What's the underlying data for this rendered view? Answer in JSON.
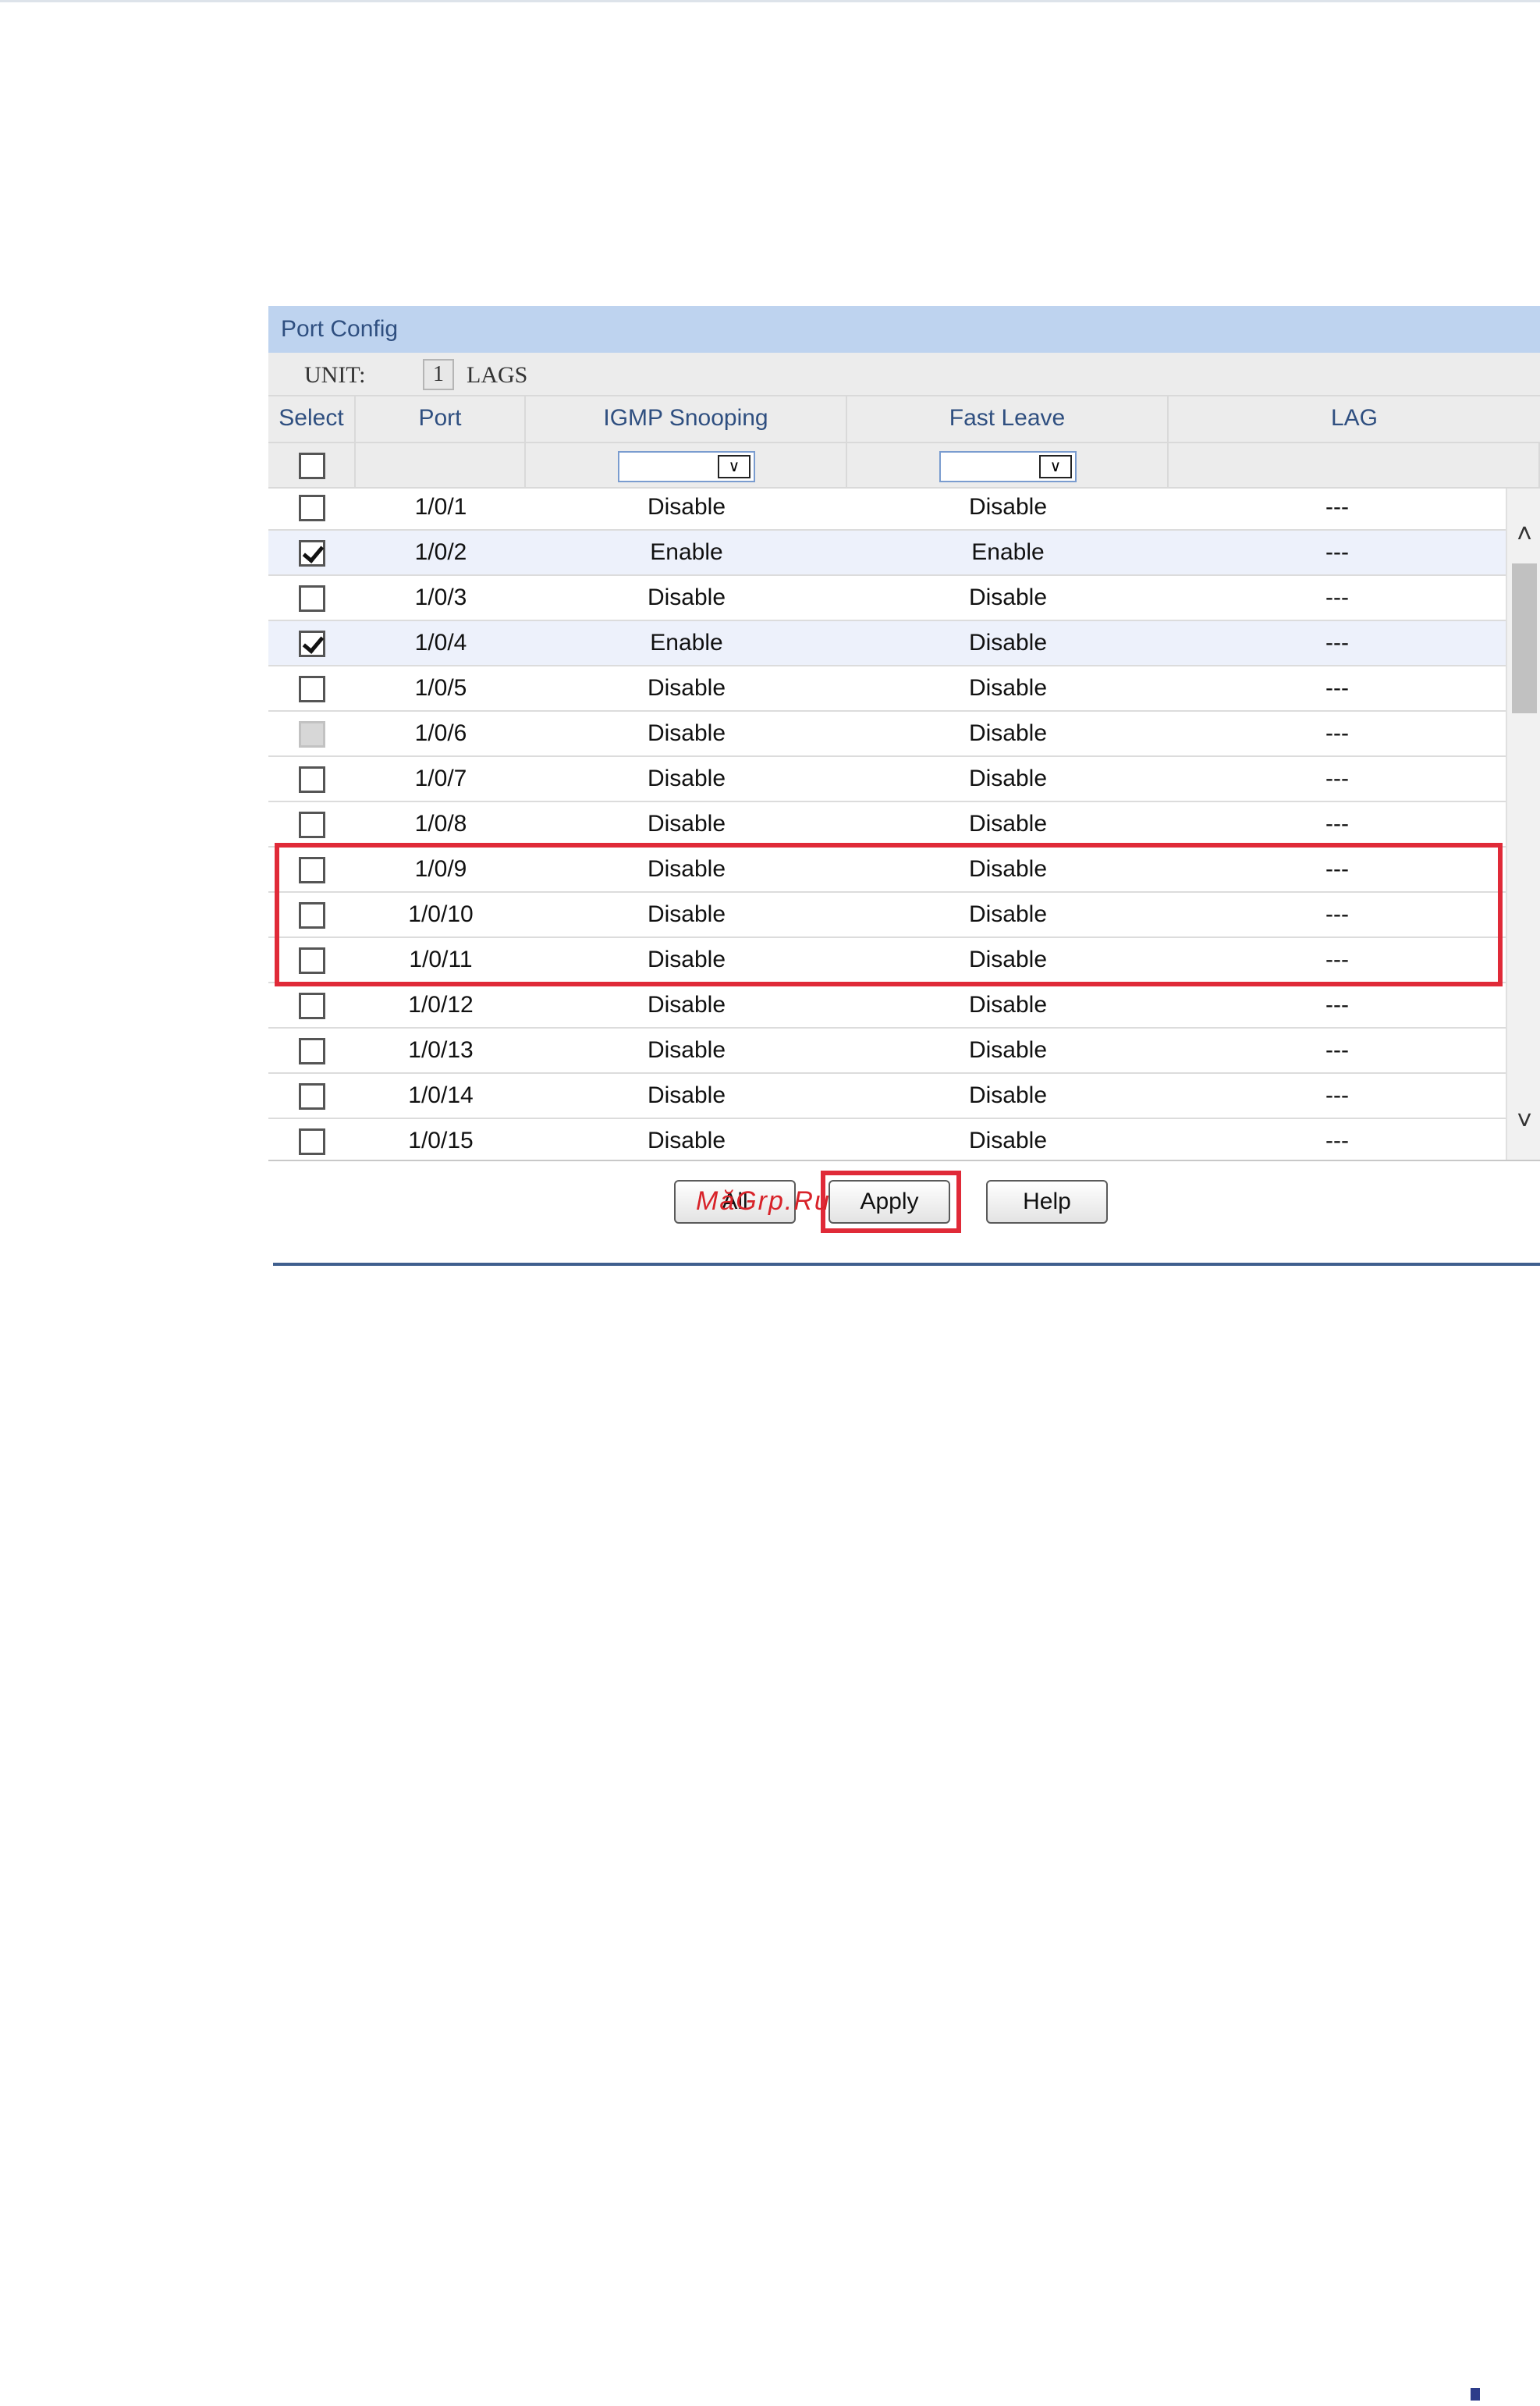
{
  "panel": {
    "title": "Port Config",
    "unit_label": "UNIT:",
    "unit_value": "1",
    "lags_label": "LAGS"
  },
  "table": {
    "headers": [
      "Select",
      "Port",
      "IGMP Snooping",
      "Fast Leave",
      "LAG"
    ],
    "filter": {
      "igmp_snooping": "",
      "fast_leave": ""
    },
    "rows": [
      {
        "select": "unchecked",
        "port": "1/0/1",
        "igmp": "Disable",
        "fast_leave": "Disable",
        "lag": "---"
      },
      {
        "select": "checked",
        "port": "1/0/2",
        "igmp": "Enable",
        "fast_leave": "Enable",
        "lag": "---"
      },
      {
        "select": "unchecked",
        "port": "1/0/3",
        "igmp": "Disable",
        "fast_leave": "Disable",
        "lag": "---"
      },
      {
        "select": "checked",
        "port": "1/0/4",
        "igmp": "Enable",
        "fast_leave": "Disable",
        "lag": "---"
      },
      {
        "select": "unchecked",
        "port": "1/0/5",
        "igmp": "Disable",
        "fast_leave": "Disable",
        "lag": "---"
      },
      {
        "select": "disabled",
        "port": "1/0/6",
        "igmp": "Disable",
        "fast_leave": "Disable",
        "lag": "---"
      },
      {
        "select": "unchecked",
        "port": "1/0/7",
        "igmp": "Disable",
        "fast_leave": "Disable",
        "lag": "---"
      },
      {
        "select": "unchecked",
        "port": "1/0/8",
        "igmp": "Disable",
        "fast_leave": "Disable",
        "lag": "---"
      },
      {
        "select": "unchecked",
        "port": "1/0/9",
        "igmp": "Disable",
        "fast_leave": "Disable",
        "lag": "---"
      },
      {
        "select": "unchecked",
        "port": "1/0/10",
        "igmp": "Disable",
        "fast_leave": "Disable",
        "lag": "---"
      },
      {
        "select": "unchecked",
        "port": "1/0/11",
        "igmp": "Disable",
        "fast_leave": "Disable",
        "lag": "---"
      },
      {
        "select": "unchecked",
        "port": "1/0/12",
        "igmp": "Disable",
        "fast_leave": "Disable",
        "lag": "---"
      },
      {
        "select": "unchecked",
        "port": "1/0/13",
        "igmp": "Disable",
        "fast_leave": "Disable",
        "lag": "---"
      },
      {
        "select": "unchecked",
        "port": "1/0/14",
        "igmp": "Disable",
        "fast_leave": "Disable",
        "lag": "---"
      },
      {
        "select": "unchecked",
        "port": "1/0/15",
        "igmp": "Disable",
        "fast_leave": "Disable",
        "lag": "---"
      }
    ]
  },
  "buttons": {
    "all": "All",
    "apply": "Apply",
    "help": "Help"
  },
  "watermark": "MăGrp.Ru",
  "colors": {
    "header_bg": "#bed3ef",
    "header_text": "#2f4f80",
    "highlight": "#e02a38",
    "selected_row_bg": "#edf1fb"
  }
}
